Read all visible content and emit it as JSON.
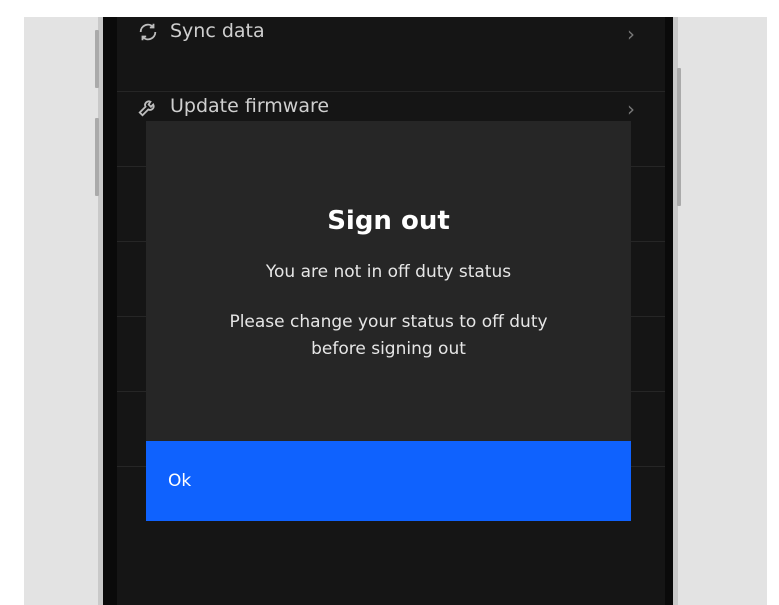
{
  "settings": {
    "items": [
      {
        "label": "Sync data",
        "icon": "sync-icon"
      },
      {
        "label": "Update firmware",
        "icon": "wrench-icon"
      }
    ]
  },
  "dialog": {
    "title": "Sign out",
    "message_primary": "You are not in off duty status",
    "message_secondary": "Please change your status to off duty before signing out",
    "ok_label": "Ok"
  },
  "colors": {
    "primary_button": "#0f62fe",
    "dialog_background": "#262626",
    "screen_background": "#151515"
  }
}
